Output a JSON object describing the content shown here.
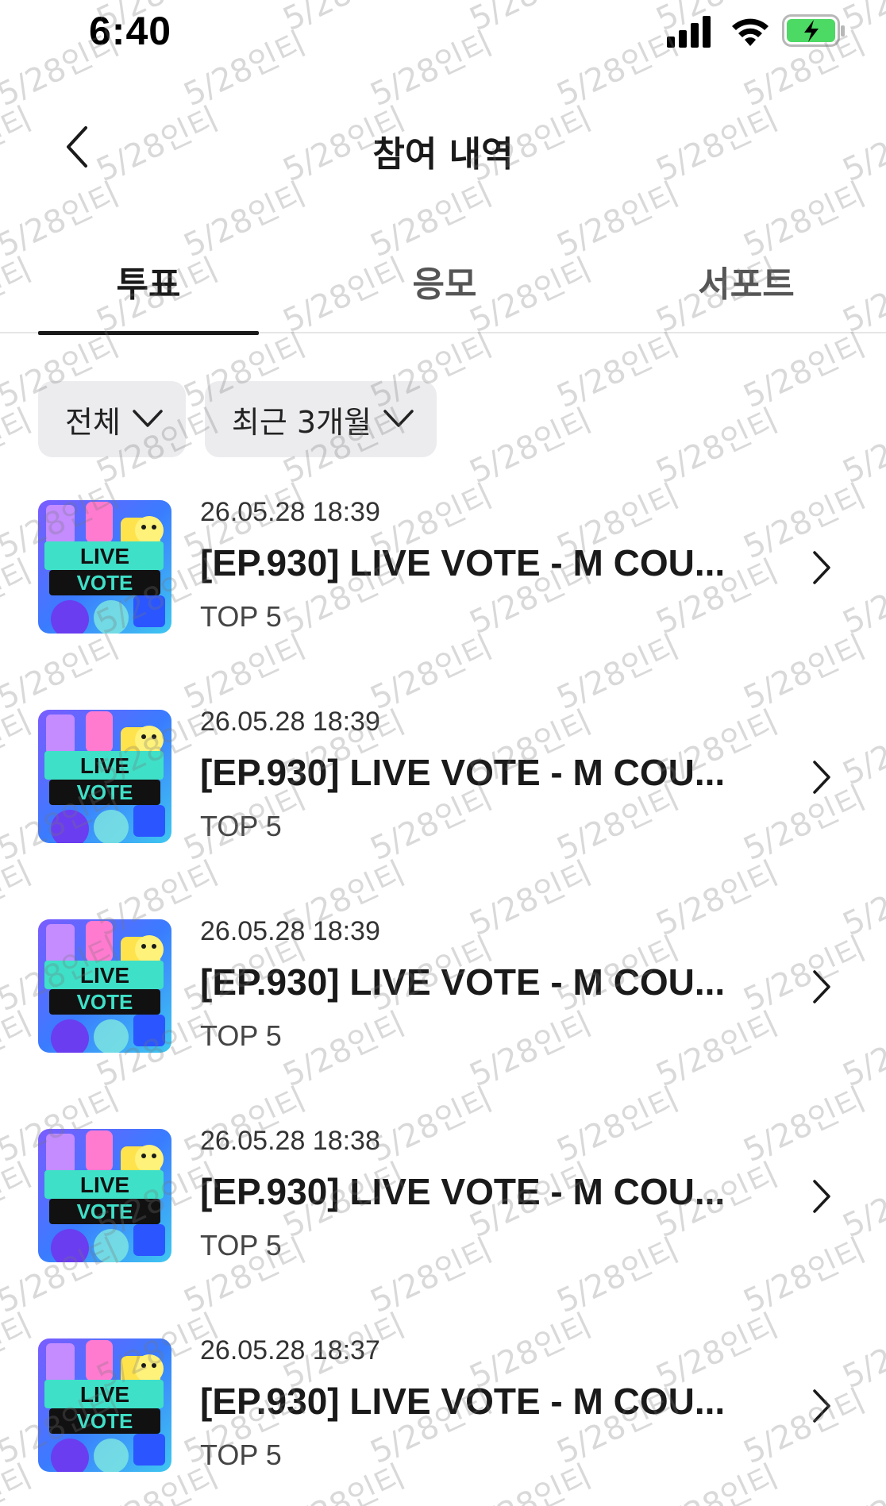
{
  "status_bar": {
    "time": "6:40",
    "icons": [
      "cellular-signal-icon",
      "wifi-icon",
      "battery-charging-icon"
    ]
  },
  "header": {
    "title": "참여 내역",
    "back_icon": "chevron-left-icon"
  },
  "tabs": [
    {
      "label": "투표",
      "active": true
    },
    {
      "label": "응모",
      "active": false
    },
    {
      "label": "서포트",
      "active": false
    }
  ],
  "filters": [
    {
      "label": "전체",
      "icon": "chevron-down-icon"
    },
    {
      "label": "최근 3개월",
      "icon": "chevron-down-icon"
    }
  ],
  "items": [
    {
      "date": "26.05.28 18:39",
      "title": "[EP.930] LIVE VOTE - M COU...",
      "subtitle": "TOP 5",
      "thumb_label_1": "LIVE",
      "thumb_label_2": "VOTE"
    },
    {
      "date": "26.05.28 18:39",
      "title": "[EP.930] LIVE VOTE - M COU...",
      "subtitle": "TOP 5",
      "thumb_label_1": "LIVE",
      "thumb_label_2": "VOTE"
    },
    {
      "date": "26.05.28 18:39",
      "title": "[EP.930] LIVE VOTE - M COU...",
      "subtitle": "TOP 5",
      "thumb_label_1": "LIVE",
      "thumb_label_2": "VOTE"
    },
    {
      "date": "26.05.28 18:38",
      "title": "[EP.930] LIVE VOTE - M COU...",
      "subtitle": "TOP 5",
      "thumb_label_1": "LIVE",
      "thumb_label_2": "VOTE"
    },
    {
      "date": "26.05.28 18:37",
      "title": "[EP.930] LIVE VOTE - M COU...",
      "subtitle": "TOP 5",
      "thumb_label_1": "LIVE",
      "thumb_label_2": "VOTE"
    }
  ],
  "watermark": "5/28인티",
  "colors": {
    "text_primary": "#1a1a1a",
    "filter_bg": "#ececef",
    "battery_green": "#4cd964",
    "thumb_teal": "#3fe0c8",
    "thumb_blue": "#3a7bff"
  }
}
